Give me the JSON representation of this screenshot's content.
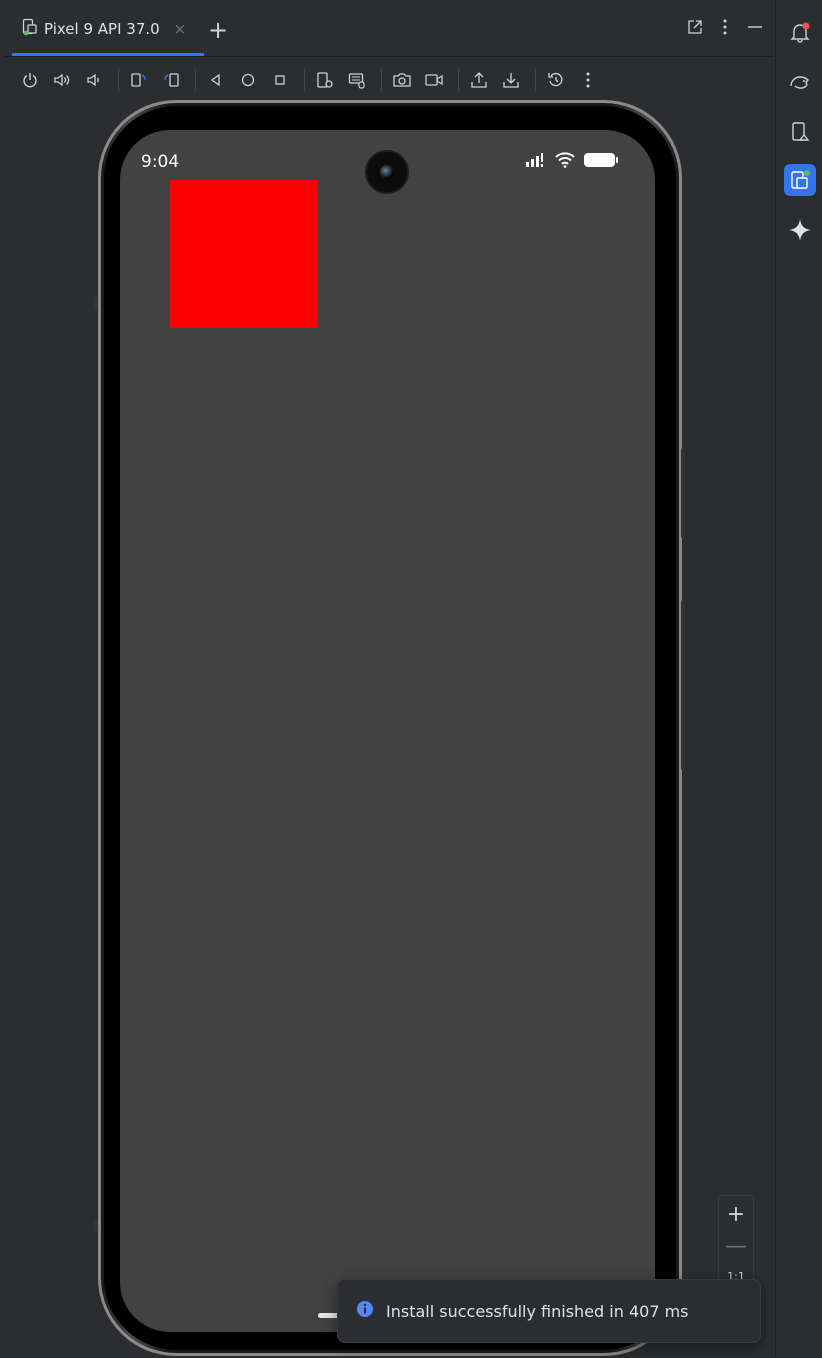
{
  "tab": {
    "label": "Pixel 9 API 37.0",
    "close_glyph": "×",
    "add_glyph": "+",
    "icon": "device-mirror-icon"
  },
  "toolbar": {
    "icons": [
      "power-icon",
      "volume-up-icon",
      "volume-down-icon",
      "rotate-left-icon",
      "rotate-right-icon",
      "back-icon",
      "home-icon",
      "overview-icon",
      "device-settings-icon",
      "keyboard-icon",
      "screenshot-icon",
      "screen-record-icon",
      "push-file-icon",
      "pull-file-icon",
      "snapshot-icon",
      "more-options-icon"
    ],
    "right_icon": "device-explorer-icon"
  },
  "device": {
    "status_time": "9:04",
    "app_content_color": "#ff0000"
  },
  "zoom": {
    "plus": "+",
    "minus": "—",
    "one_to_one": "1:1"
  },
  "toast": {
    "message": "Install successfully finished in 407 ms"
  },
  "right_strip": {
    "icons": [
      "notifications-icon",
      "gemini-icon",
      "device-manager-icon",
      "running-devices-icon",
      "ai-sparkle-icon"
    ]
  },
  "colors": {
    "accent": "#3574f0",
    "notification_dot": "#e55252",
    "active_dot": "#5fb865"
  }
}
